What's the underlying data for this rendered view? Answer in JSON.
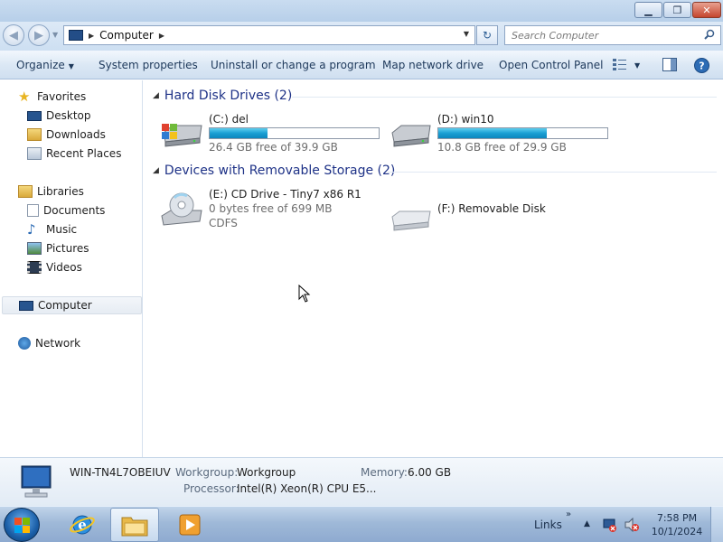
{
  "window": {
    "minimize_label": "▭",
    "maximize_label": "⧉",
    "close_label": "✕"
  },
  "address": {
    "crumb": "Computer",
    "search_placeholder": "Search Computer"
  },
  "toolbar": {
    "organize": "Organize",
    "system_properties": "System properties",
    "uninstall": "Uninstall or change a program",
    "map_drive": "Map network drive",
    "control_panel": "Open Control Panel"
  },
  "nav": {
    "favorites": "Favorites",
    "desktop": "Desktop",
    "downloads": "Downloads",
    "recent_places": "Recent Places",
    "libraries": "Libraries",
    "documents": "Documents",
    "music": "Music",
    "pictures": "Pictures",
    "videos": "Videos",
    "computer": "Computer",
    "network": "Network"
  },
  "groups": {
    "hdd": "Hard Disk Drives (2)",
    "removable": "Devices with Removable Storage (2)"
  },
  "drives": {
    "c": {
      "name": "(C:) del",
      "free": "26.4 GB free of 39.9 GB",
      "used_fraction": 0.34
    },
    "d": {
      "name": "(D:) win10",
      "free": "10.8 GB free of 29.9 GB",
      "used_fraction": 0.64
    },
    "e": {
      "name": "(E:) CD Drive - Tiny7 x86 R1",
      "free": "0 bytes free of 699 MB",
      "fs": "CDFS"
    },
    "f": {
      "name": "(F:) Removable Disk"
    }
  },
  "details": {
    "computer_name": "WIN-TN4L7OBEIUV",
    "workgroup_label": "Workgroup:",
    "workgroup_value": "Workgroup",
    "memory_label": "Memory:",
    "memory_value": "6.00 GB",
    "processor_label": "Processor:",
    "processor_value": "Intel(R) Xeon(R) CPU E5..."
  },
  "taskbar": {
    "links": "Links",
    "time": "7:58 PM",
    "date": "10/1/2024"
  },
  "colors": {
    "accent": "#1e3287",
    "toolbar_text": "#1e395b",
    "bar_fill": "#1a9ed3"
  }
}
